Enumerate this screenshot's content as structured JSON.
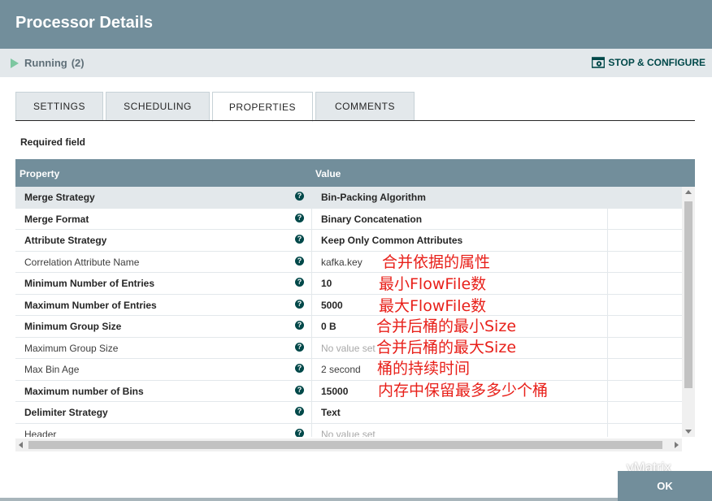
{
  "dialog": {
    "title": "Processor Details"
  },
  "status": {
    "state": "Running",
    "count": "(2)",
    "stop_configure_label": "STOP & CONFIGURE"
  },
  "tabs": [
    {
      "label": "SETTINGS",
      "active": false
    },
    {
      "label": "SCHEDULING",
      "active": false
    },
    {
      "label": "PROPERTIES",
      "active": true
    },
    {
      "label": "COMMENTS",
      "active": false
    }
  ],
  "required_field_label": "Required field",
  "grid": {
    "headers": {
      "property": "Property",
      "value": "Value"
    },
    "help_glyph": "?",
    "rows": [
      {
        "property": "Merge Strategy",
        "value": "Bin-Packing Algorithm",
        "required": true,
        "value_set": true
      },
      {
        "property": "Merge Format",
        "value": "Binary Concatenation",
        "required": true,
        "value_set": true
      },
      {
        "property": "Attribute Strategy",
        "value": "Keep Only Common Attributes",
        "required": true,
        "value_set": true
      },
      {
        "property": "Correlation Attribute Name",
        "value": "kafka.key",
        "required": false,
        "value_set": true
      },
      {
        "property": "Minimum Number of Entries",
        "value": "10",
        "required": true,
        "value_set": true
      },
      {
        "property": "Maximum Number of Entries",
        "value": "5000",
        "required": true,
        "value_set": true
      },
      {
        "property": "Minimum Group Size",
        "value": "0 B",
        "required": true,
        "value_set": true
      },
      {
        "property": "Maximum Group Size",
        "value": "No value set",
        "required": false,
        "value_set": false
      },
      {
        "property": "Max Bin Age",
        "value": "2 second",
        "required": false,
        "value_set": true
      },
      {
        "property": "Maximum number of Bins",
        "value": "15000",
        "required": true,
        "value_set": true
      },
      {
        "property": "Delimiter Strategy",
        "value": "Text",
        "required": true,
        "value_set": true
      },
      {
        "property": "Header",
        "value": "No value set",
        "required": false,
        "value_set": false
      }
    ]
  },
  "annotations": [
    "合并依据的属性",
    "最小FlowFile数",
    "最大FlowFile数",
    "合并后桶的最小Size",
    "合并后桶的最大Size",
    "桶的持续时间",
    "内存中保留最多多少个桶"
  ],
  "watermark": "yMatrix",
  "ok_label": "OK",
  "colors": {
    "header": "#728e9b",
    "accent": "#004849",
    "annotation": "#e8201a",
    "running": "#7dc7a0"
  }
}
